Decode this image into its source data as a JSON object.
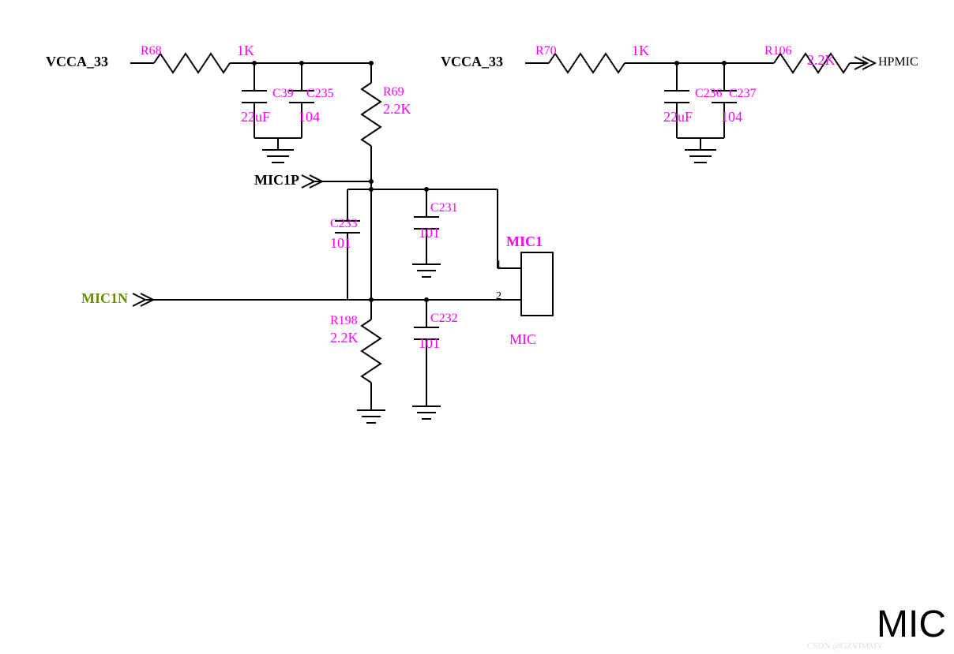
{
  "title": "MIC",
  "watermark": "CSDN @GZVIMMY",
  "nets": {
    "vcca_left": "VCCA_33",
    "vcca_right": "VCCA_33",
    "hpmic": "HPMIC",
    "mic1p": "MIC1P",
    "mic1n": "MIC1N",
    "mic_label": "MIC"
  },
  "parts": {
    "R68": {
      "ref": "R68",
      "val": "1K"
    },
    "R69": {
      "ref": "R69",
      "val": "2.2K"
    },
    "R70": {
      "ref": "R70",
      "val": "1K"
    },
    "R106": {
      "ref": "R106",
      "val": "2.2K"
    },
    "R198": {
      "ref": "R198",
      "val": "2.2K"
    },
    "C39": {
      "ref": "C39",
      "val": "22uF"
    },
    "C235": {
      "ref": "C235",
      "val": "104"
    },
    "C236": {
      "ref": "C236",
      "val": "22uF"
    },
    "C237": {
      "ref": "C237",
      "val": "104"
    },
    "C231": {
      "ref": "C231",
      "val": "101"
    },
    "C232": {
      "ref": "C232",
      "val": "101"
    },
    "C233": {
      "ref": "C233",
      "val": "101"
    },
    "MIC1": {
      "ref": "MIC1",
      "pin1": "1",
      "pin2": "2"
    }
  }
}
